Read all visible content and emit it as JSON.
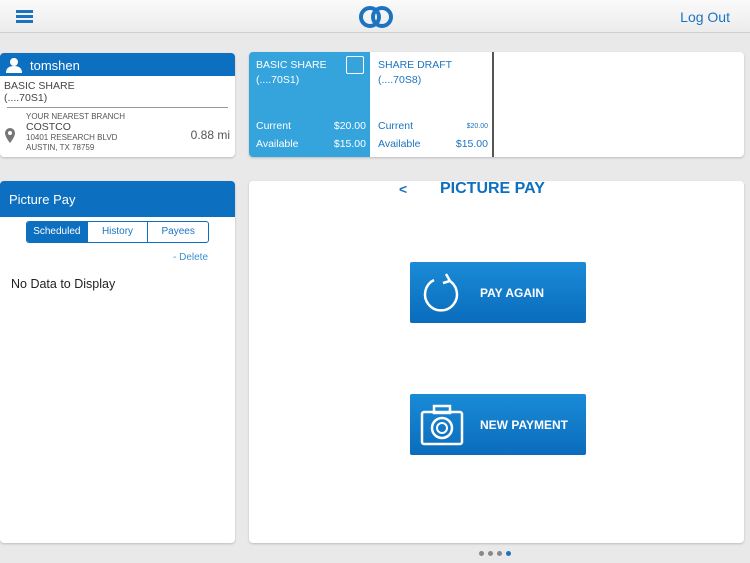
{
  "header": {
    "logout": "Log Out"
  },
  "user": {
    "name": "tomshen",
    "account_name": "BASIC SHARE",
    "account_no": "(....70S1)",
    "branch_label": "YOUR NEAREST BRANCH",
    "branch_name": "COSTCO",
    "address1": "10401 RESEARCH BLVD",
    "address2": "AUSTIN, TX 78759",
    "distance": "0.88 mi"
  },
  "accounts": [
    {
      "name": "BASIC SHARE",
      "number": "(....70S1)",
      "current_label": "Current",
      "current": "$20.00",
      "available_label": "Available",
      "available": "$15.00",
      "selected": true
    },
    {
      "name": "SHARE DRAFT",
      "number": "(....70S8)",
      "current_label": "Current",
      "current": "$20.00",
      "available_label": "Available",
      "available": "$15.00",
      "selected": false
    }
  ],
  "picture_pay": {
    "title": "Picture Pay",
    "tabs": [
      "Scheduled",
      "History",
      "Payees"
    ],
    "active_tab": "Scheduled",
    "delete": "- Delete",
    "empty": "No Data to Display"
  },
  "main": {
    "back": "<",
    "title": "PICTURE PAY",
    "pay_again": "PAY AGAIN",
    "new_payment": "NEW PAYMENT"
  },
  "pager": {
    "pages": 4,
    "current": 4
  },
  "colors": {
    "primary": "#0d6fbf",
    "selected_tile": "#35a4dd"
  }
}
